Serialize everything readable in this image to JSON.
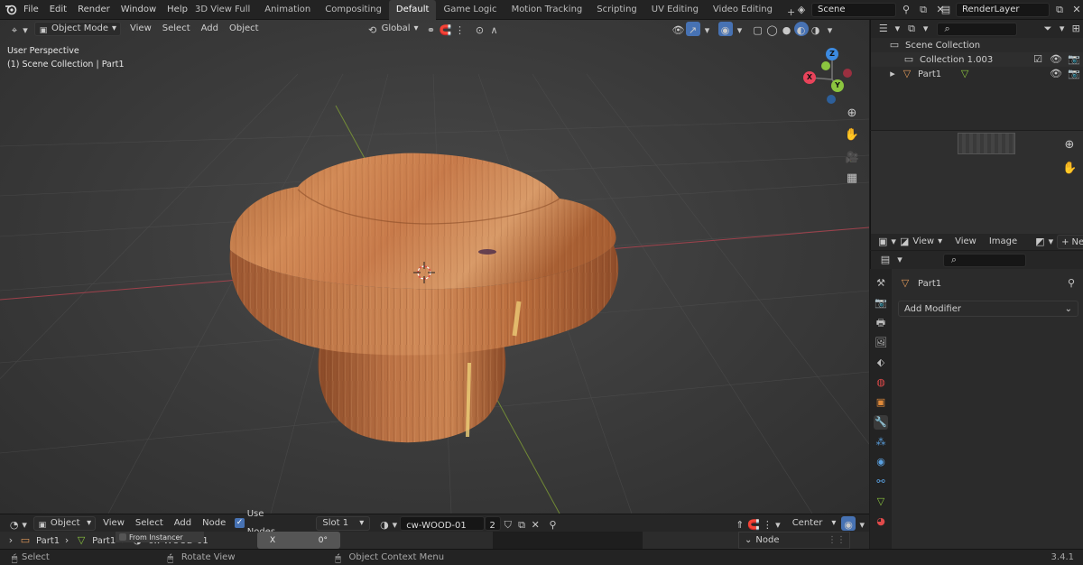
{
  "topbar": {
    "menus": [
      "File",
      "Edit",
      "Render",
      "Window",
      "Help"
    ],
    "workspaces": [
      "3D View Full",
      "Animation",
      "Compositing",
      "Default",
      "Game Logic",
      "Motion Tracking",
      "Scripting",
      "UV Editing",
      "Video Editing"
    ],
    "active_workspace": "Default",
    "scene": "Scene",
    "view_layer": "RenderLayer"
  },
  "viewport": {
    "mode": "Object Mode",
    "menus": [
      "View",
      "Select",
      "Add",
      "Object"
    ],
    "transform_orientation": "Global",
    "info_line1": "User Perspective",
    "info_line2": "(1) Scene Collection | Part1",
    "gizmo": {
      "z": "Z",
      "y": "Y",
      "x": "X"
    }
  },
  "outliner": {
    "root": "Scene Collection",
    "collection": "Collection 1.003",
    "object": "Part1"
  },
  "image_editor": {
    "view_menu": "View",
    "menus": [
      "View",
      "Image"
    ],
    "new_label": "Ne"
  },
  "properties": {
    "object_name": "Part1",
    "add_modifier": "Add Modifier"
  },
  "node_editor": {
    "type": "Object",
    "menus": [
      "View",
      "Select",
      "Add",
      "Node"
    ],
    "use_nodes": "Use Nodes",
    "slot": "Slot 1",
    "material": "cw-WOOD-01",
    "users": "2",
    "pivot": "Center",
    "breadcrumb": [
      "Part1",
      "Part1",
      "cw-WOOD-01"
    ],
    "from_instancer": "From Instancer",
    "x_label": "X",
    "x_value": "0°",
    "node_tab": "Node"
  },
  "statusbar": {
    "select": "Select",
    "rotate": "Rotate View",
    "context": "Object Context Menu",
    "version": "3.4.1"
  },
  "colors": {
    "accent": "#4772b3",
    "axis_x": "#e8435a",
    "axis_y": "#8bc53f",
    "axis_z": "#3c8ae0",
    "wood": "#c77a4a"
  }
}
